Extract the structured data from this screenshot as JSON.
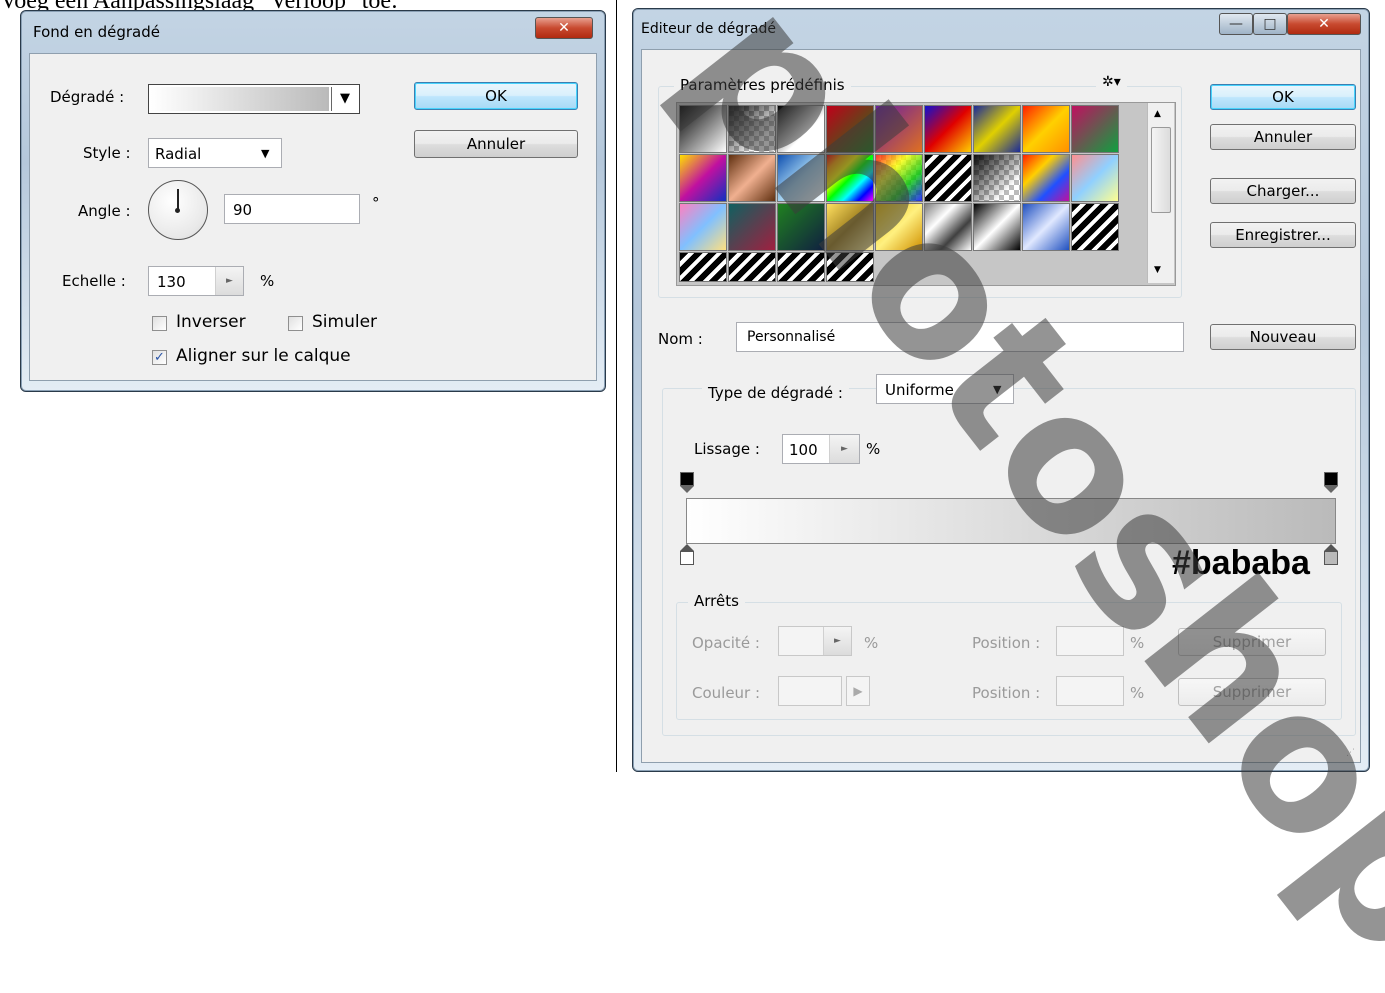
{
  "top_text": "Voeg een Aanpassingslaag \"Verloop\" toe:",
  "left_dialog": {
    "title": "Fond en dégradé",
    "close_glyph": "✕",
    "gradient_label": "Dégradé :",
    "style_label": "Style :",
    "style_value": "Radial",
    "angle_label": "Angle :",
    "angle_value": "90",
    "degree_symbol": "°",
    "scale_label": "Echelle :",
    "scale_value": "130",
    "percent": "%",
    "reverse_label": "Inverser",
    "reverse_checked": false,
    "dither_label": "Simuler",
    "dither_checked": false,
    "align_label": "Aligner sur le calque",
    "align_checked": true,
    "ok_label": "OK",
    "cancel_label": "Annuler"
  },
  "editor": {
    "title": "Editeur de dégradé",
    "presets_label": "Paramètres prédéfinis",
    "gear_icon": "gear-icon",
    "ok_label": "OK",
    "cancel_label": "Annuler",
    "load_label": "Charger...",
    "save_label": "Enregistrer...",
    "name_label": "Nom :",
    "name_value": "Personnalisé",
    "new_label": "Nouveau",
    "type_label": "Type de dégradé :",
    "type_value": "Uniforme",
    "smoothness_label": "Lissage :",
    "smoothness_value": "100",
    "percent": "%",
    "stop_color_annotation": "#bababa",
    "stops_label": "Arrêts",
    "opacity_label": "Opacité :",
    "color_label": "Couleur :",
    "position_label": "Position :",
    "delete_label": "Supprimer",
    "gradient_stops": [
      {
        "location": 0,
        "color": "#ffffff"
      },
      {
        "location": 1,
        "color": "#bababa"
      }
    ],
    "preset_swatches": [
      [
        "linear-gradient(135deg,#000 0%,#fff 100%)",
        "checker-fade",
        "linear-gradient(135deg,#000 0%,#fff 60%,#fff 100%)",
        "linear-gradient(135deg,#c0001a,#1a7a1a)",
        "linear-gradient(135deg,#6a1fa0,#e07020)",
        "linear-gradient(135deg,#1010d0,#e00000,#ffd000)",
        "linear-gradient(135deg,#1a2a9a,#e0d000 50%,#1a2a9a)",
        "linear-gradient(135deg,#ff2000,#ffd000,#ff9000)",
        "linear-gradient(135deg,#c01060,#10a040)"
      ],
      [
        "linear-gradient(135deg,#ffe000,#c010a0,#1030c0)",
        "linear-gradient(135deg,#603010,#f0b090,#603010)",
        "linear-gradient(135deg,#1050b0,#a0d0f0,#ffffff)",
        "linear-gradient(135deg,red,orange,yellow,lime,cyan,blue,magenta)",
        "checker-rainbow",
        "stripes-bw",
        "checker-fade",
        "linear-gradient(135deg,#ff2000,#ffd000,#2050ff,#c010a0)",
        "linear-gradient(135deg,#ff9090,#90d0ff,#ffff90)"
      ],
      [
        "linear-gradient(135deg,#ff80c0,#80c0ff,#ffe080)",
        "linear-gradient(135deg,#106060,#a02040)",
        "linear-gradient(135deg,#208020,#102040)",
        "linear-gradient(135deg,#ffe060,#a08020,#fff0a0)",
        "linear-gradient(135deg,#f0c000,#fff080,#d09000)",
        "linear-gradient(135deg,#808080,#fff,#404040,#fff)",
        "linear-gradient(135deg,#000,#fff,#000)",
        "linear-gradient(135deg,#2050c0,#e0e8ff,#2050c0)",
        "stripes-bw"
      ],
      [
        "stripes-bw",
        "stripes-bw",
        "stripes-bw",
        "stripes-bw"
      ]
    ]
  }
}
